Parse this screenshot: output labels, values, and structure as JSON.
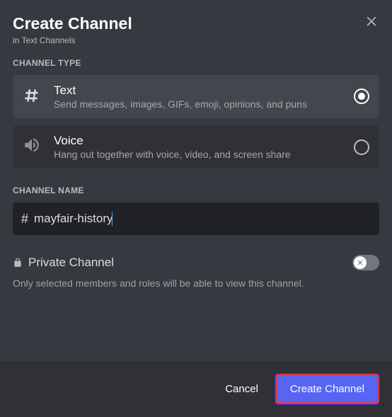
{
  "header": {
    "title": "Create Channel",
    "subtitle": "in Text Channels"
  },
  "channel_type": {
    "label": "CHANNEL TYPE",
    "options": [
      {
        "key": "text",
        "name": "Text",
        "desc": "Send messages, images, GIFs, emoji, opinions, and puns",
        "selected": true
      },
      {
        "key": "voice",
        "name": "Voice",
        "desc": "Hang out together with voice, video, and screen share",
        "selected": false
      }
    ]
  },
  "channel_name": {
    "label": "CHANNEL NAME",
    "value": "mayfair-history"
  },
  "private": {
    "label": "Private Channel",
    "enabled": false,
    "desc": "Only selected members and roles will be able to view this channel."
  },
  "footer": {
    "cancel": "Cancel",
    "create": "Create Channel"
  }
}
